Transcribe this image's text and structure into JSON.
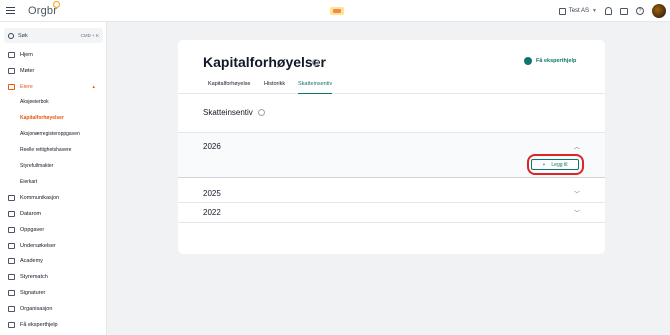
{
  "app": {
    "logo": "Orgbr"
  },
  "topbar": {
    "company": "Test AS"
  },
  "sidebar": {
    "search_placeholder": "Søk",
    "search_shortcut": "CMD + K",
    "items": [
      {
        "label": "Hjem"
      },
      {
        "label": "Møter"
      },
      {
        "label": "Eiere"
      },
      {
        "label": "Kommunikasjon"
      },
      {
        "label": "Datarom"
      },
      {
        "label": "Oppgaver"
      },
      {
        "label": "Undersøkelser"
      },
      {
        "label": "Academy"
      },
      {
        "label": "Styrematch"
      },
      {
        "label": "Signaturer"
      },
      {
        "label": "Organisasjon"
      },
      {
        "label": "Få eksperthjelp"
      }
    ],
    "eiere_sub": [
      {
        "label": "Aksjeeierbok"
      },
      {
        "label": "Kapitalforhøyelser"
      },
      {
        "label": "Aksjonærregisteroppgaven"
      },
      {
        "label": "Reelle rettighetshavere"
      },
      {
        "label": "Styrefullmakter"
      },
      {
        "label": "Eierkart"
      }
    ]
  },
  "main": {
    "title": "Kapitalforhøyelser",
    "expert_help": "Få eksperthjelp",
    "tabs": [
      {
        "label": "Kapitalforhøyelse"
      },
      {
        "label": "Historikk"
      },
      {
        "label": "Skatteinsentiv"
      }
    ],
    "section_title": "Skatteinsentiv",
    "years": [
      {
        "year": "2026",
        "expanded": true
      },
      {
        "year": "2025",
        "expanded": false
      },
      {
        "year": "2022",
        "expanded": false
      }
    ],
    "add_button": "Legg til"
  },
  "colors": {
    "accent": "#ea580c",
    "brand": "#0f766e",
    "highlight": "#dc2626"
  }
}
